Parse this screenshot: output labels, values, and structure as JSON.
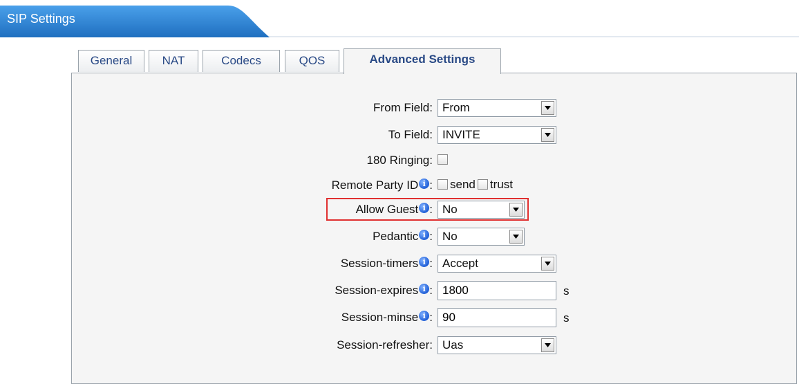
{
  "header": {
    "title": "SIP Settings"
  },
  "tabs": [
    {
      "label": "General",
      "active": false
    },
    {
      "label": "NAT",
      "active": false
    },
    {
      "label": "Codecs",
      "active": false
    },
    {
      "label": "QOS",
      "active": false
    },
    {
      "label": "Advanced Settings",
      "active": true
    }
  ],
  "form": {
    "from_field": {
      "label": "From Field",
      "value": "From"
    },
    "to_field": {
      "label": "To Field",
      "value": "INVITE"
    },
    "ringing_180": {
      "label": "180 Ringing",
      "checked": false
    },
    "remote_party_id": {
      "label": "Remote Party ID",
      "send_label": "send",
      "trust_label": "trust"
    },
    "allow_guest": {
      "label": "Allow Guest",
      "value": "No"
    },
    "pedantic": {
      "label": "Pedantic",
      "value": "No"
    },
    "session_timers": {
      "label": "Session-timers",
      "value": "Accept"
    },
    "session_expires": {
      "label": "Session-expires",
      "value": "1800",
      "unit": "s"
    },
    "session_minse": {
      "label": "Session-minse",
      "value": "90",
      "unit": "s"
    },
    "session_refresher": {
      "label": "Session-refresher",
      "value": "Uas"
    }
  },
  "colon": ":",
  "info_glyph": "i",
  "colors": {
    "header_blue": "#2f86d6",
    "tab_text": "#2a4a86",
    "highlight": "#e03030",
    "panel_bg": "#f5f5f5"
  }
}
